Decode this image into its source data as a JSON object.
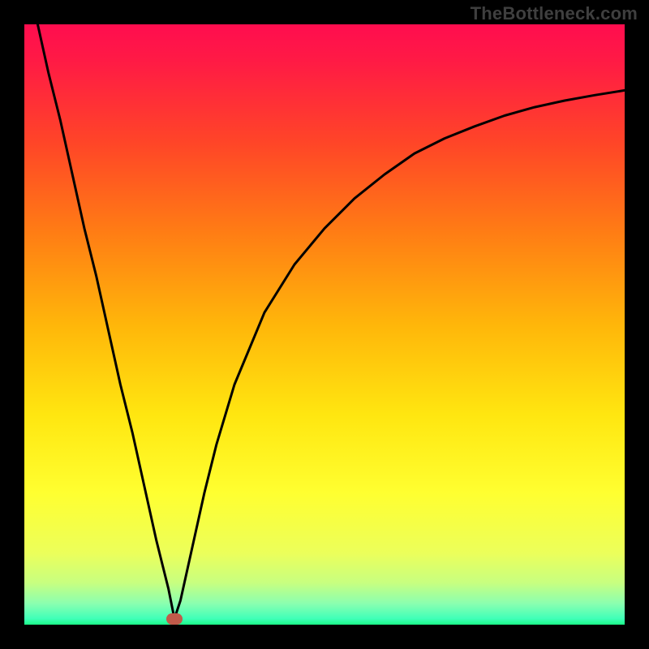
{
  "watermark": "TheBottleneck.com",
  "chart_data": {
    "type": "line",
    "title": "",
    "xlabel": "",
    "ylabel": "",
    "xlim": [
      0,
      100
    ],
    "ylim": [
      0,
      100
    ],
    "x": [
      0,
      2,
      4,
      6,
      8,
      10,
      12,
      14,
      16,
      18,
      20,
      22,
      24,
      25,
      26,
      28,
      30,
      32,
      35,
      40,
      45,
      50,
      55,
      60,
      65,
      70,
      75,
      80,
      85,
      90,
      95,
      100
    ],
    "values": [
      110,
      101,
      92,
      84,
      75,
      66,
      58,
      49,
      40,
      32,
      23,
      14,
      6,
      1,
      4,
      13,
      22,
      30,
      40,
      52,
      60,
      66,
      71,
      75,
      78.5,
      81,
      83,
      84.8,
      86.2,
      87.3,
      88.2,
      89
    ],
    "min_point": {
      "x": 25,
      "y": 1
    },
    "gradient_stops": [
      {
        "pos": 0.0,
        "color": "#ff0d4f"
      },
      {
        "pos": 0.06,
        "color": "#ff1a45"
      },
      {
        "pos": 0.2,
        "color": "#ff4627"
      },
      {
        "pos": 0.35,
        "color": "#ff7e14"
      },
      {
        "pos": 0.5,
        "color": "#ffb60a"
      },
      {
        "pos": 0.65,
        "color": "#ffe610"
      },
      {
        "pos": 0.78,
        "color": "#ffff30"
      },
      {
        "pos": 0.88,
        "color": "#ecff5a"
      },
      {
        "pos": 0.93,
        "color": "#c8ff80"
      },
      {
        "pos": 0.965,
        "color": "#8affb0"
      },
      {
        "pos": 0.99,
        "color": "#40ffb8"
      },
      {
        "pos": 1.0,
        "color": "#1afc88"
      }
    ],
    "marker_color": "#c15a4a",
    "curve_color": "#000000"
  }
}
